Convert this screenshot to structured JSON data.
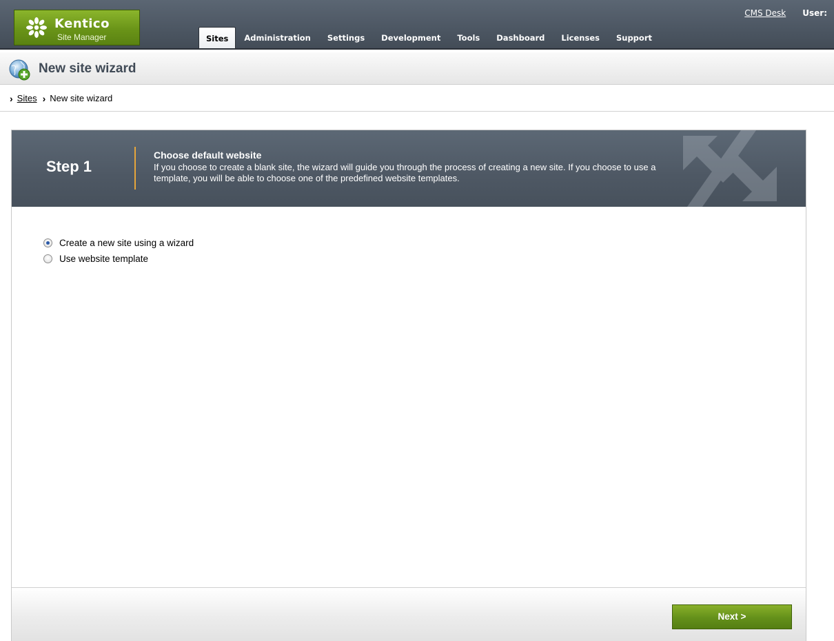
{
  "app": {
    "brand_name": "Kentico",
    "brand_sub": "Site Manager"
  },
  "nav": {
    "tabs": [
      {
        "label": "Sites",
        "active": true
      },
      {
        "label": "Administration"
      },
      {
        "label": "Settings"
      },
      {
        "label": "Development"
      },
      {
        "label": "Tools"
      },
      {
        "label": "Dashboard"
      },
      {
        "label": "Licenses"
      },
      {
        "label": "Support"
      }
    ],
    "cms_desk_link": "CMS Desk",
    "user_label": "User:"
  },
  "page": {
    "title": "New site wizard",
    "title_icon": "globe-add-icon"
  },
  "breadcrumb": {
    "items": [
      "Sites",
      "New site wizard"
    ]
  },
  "wizard": {
    "step_label": "Step 1",
    "step_title": "Choose default website",
    "step_description": "If you choose to create a blank site, the wizard will guide you through the process of creating a new site. If you choose to use a template, you will be able to choose one of the predefined website templates.",
    "options": [
      {
        "label": "Create a new site using a wizard",
        "selected": true
      },
      {
        "label": "Use website template",
        "selected": false
      }
    ],
    "next_label": "Next >"
  },
  "colors": {
    "header_bg": "#4e5864",
    "brand_green": "#6a9418",
    "step_divider": "#e7a63b"
  }
}
